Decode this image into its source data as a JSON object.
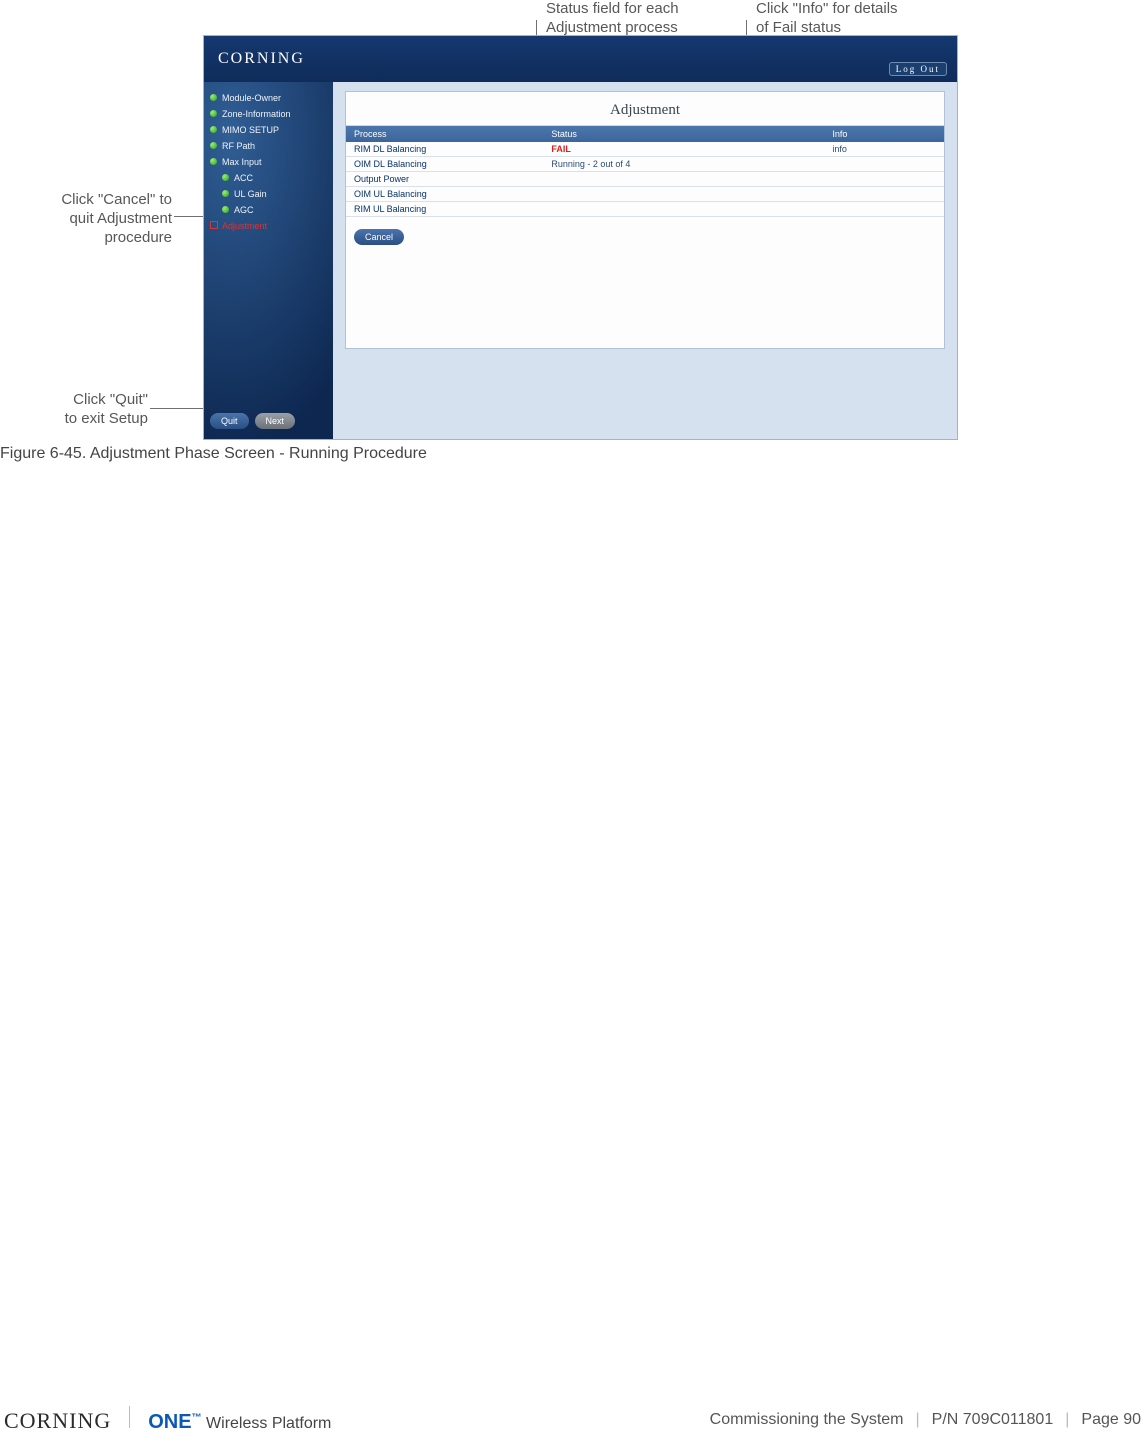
{
  "callouts": {
    "status": "Status field for each\nAdjustment process",
    "info": "Click \"Info\" for details\nof Fail status",
    "cancel": "Click \"Cancel\" to\nquit Adjustment\nprocedure",
    "quit": "Click \"Quit\"\nto exit Setup"
  },
  "app": {
    "brand": "CORNING",
    "logout": "Log Out",
    "sidebar": {
      "items": [
        {
          "label": "Module-Owner",
          "kind": "dot"
        },
        {
          "label": "Zone-Information",
          "kind": "dot"
        },
        {
          "label": "MIMO SETUP",
          "kind": "dot"
        },
        {
          "label": "RF Path",
          "kind": "dot"
        },
        {
          "label": "Max Input",
          "kind": "dot"
        },
        {
          "label": "ACC",
          "kind": "dot",
          "indent": true
        },
        {
          "label": "UL Gain",
          "kind": "dot",
          "indent": true
        },
        {
          "label": "AGC",
          "kind": "dot",
          "indent": true
        },
        {
          "label": "Adjustment",
          "kind": "active"
        }
      ],
      "buttons": {
        "quit": "Quit",
        "next": "Next"
      }
    },
    "panel": {
      "title": "Adjustment",
      "headers": {
        "process": "Process",
        "status": "Status",
        "info": "Info"
      },
      "rows": [
        {
          "process": "RIM DL Balancing",
          "status": "FAIL",
          "status_class": "fail",
          "info": "info"
        },
        {
          "process": "OIM DL Balancing",
          "status": "Running - 2 out of 4",
          "status_class": "",
          "info": ""
        },
        {
          "process": "Output Power",
          "status": "",
          "status_class": "",
          "info": ""
        },
        {
          "process": "OIM UL Balancing",
          "status": "",
          "status_class": "",
          "info": ""
        },
        {
          "process": "RIM UL Balancing",
          "status": "",
          "status_class": "",
          "info": ""
        }
      ],
      "cancel": "Cancel"
    }
  },
  "figure_caption": "Figure 6-45. Adjustment Phase Screen - Running Procedure",
  "footer": {
    "brand": "CORNING",
    "product_prefix": "ONE",
    "product_tm": "™",
    "product_suffix": "Wireless Platform",
    "section": "Commissioning the System",
    "pn": "P/N 709C011801",
    "page": "Page 90"
  }
}
